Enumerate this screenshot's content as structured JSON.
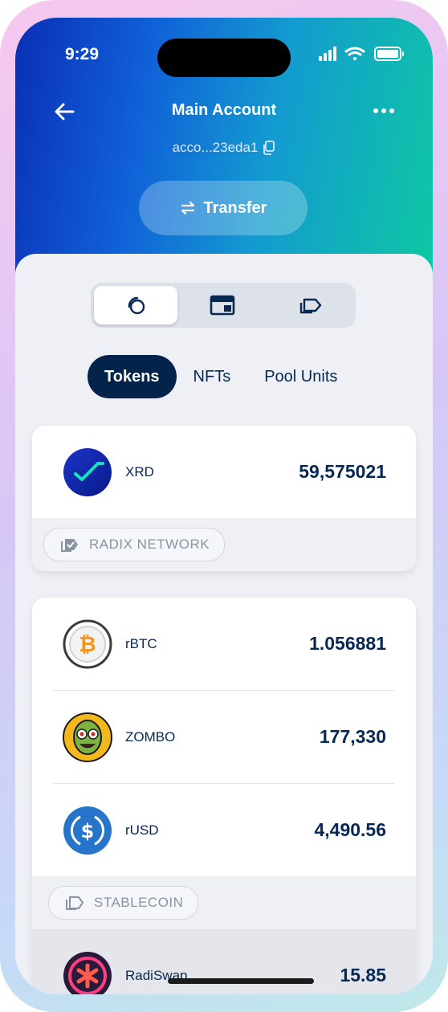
{
  "status_bar": {
    "time": "9:29"
  },
  "header": {
    "title": "Main Account",
    "address": "acco...23eda1",
    "transfer_label": "Transfer"
  },
  "view_toggle": {
    "icons": [
      "coins-icon",
      "wallet-card-icon",
      "tag-icon"
    ],
    "active_index": 0
  },
  "tabs": [
    {
      "label": "Tokens",
      "active": true
    },
    {
      "label": "NFTs",
      "active": false
    },
    {
      "label": "Pool Units",
      "active": false
    }
  ],
  "cards": [
    {
      "tag": "RADIX NETWORK",
      "tokens": [
        {
          "symbol": "XRD",
          "amount": "59,575021",
          "icon": "xrd-icon"
        }
      ]
    },
    {
      "tag": "STABLECOIN",
      "tokens": [
        {
          "symbol": "rBTC",
          "amount": "1.056881",
          "icon": "bitcoin-icon"
        },
        {
          "symbol": "ZOMBO",
          "amount": "177,330",
          "icon": "zombie-icon"
        },
        {
          "symbol": "rUSD",
          "amount": "4,490.56",
          "icon": "usd-coin-icon"
        }
      ]
    },
    {
      "tokens": [
        {
          "symbol": "RadiSwap",
          "amount": "15.85",
          "icon": "radiswap-icon"
        }
      ]
    }
  ],
  "colors": {
    "header_gradient": [
      "#0a2fb5",
      "#139bd0",
      "#0ec8a3"
    ],
    "active_tab": "#03234a",
    "text_primary": "#062852"
  }
}
